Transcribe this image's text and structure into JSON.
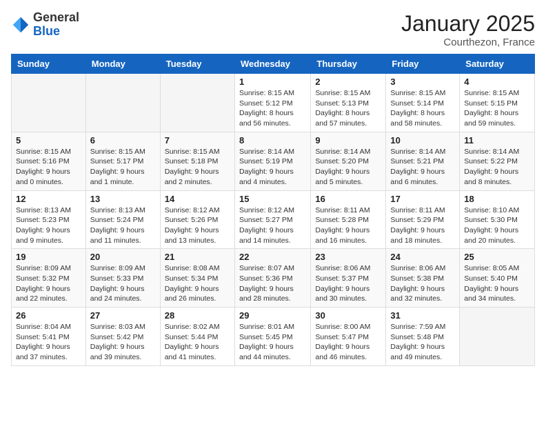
{
  "logo": {
    "general": "General",
    "blue": "Blue"
  },
  "header": {
    "month": "January 2025",
    "location": "Courthezon, France"
  },
  "weekdays": [
    "Sunday",
    "Monday",
    "Tuesday",
    "Wednesday",
    "Thursday",
    "Friday",
    "Saturday"
  ],
  "weeks": [
    [
      {
        "day": "",
        "info": ""
      },
      {
        "day": "",
        "info": ""
      },
      {
        "day": "",
        "info": ""
      },
      {
        "day": "1",
        "info": "Sunrise: 8:15 AM\nSunset: 5:12 PM\nDaylight: 8 hours\nand 56 minutes."
      },
      {
        "day": "2",
        "info": "Sunrise: 8:15 AM\nSunset: 5:13 PM\nDaylight: 8 hours\nand 57 minutes."
      },
      {
        "day": "3",
        "info": "Sunrise: 8:15 AM\nSunset: 5:14 PM\nDaylight: 8 hours\nand 58 minutes."
      },
      {
        "day": "4",
        "info": "Sunrise: 8:15 AM\nSunset: 5:15 PM\nDaylight: 8 hours\nand 59 minutes."
      }
    ],
    [
      {
        "day": "5",
        "info": "Sunrise: 8:15 AM\nSunset: 5:16 PM\nDaylight: 9 hours\nand 0 minutes."
      },
      {
        "day": "6",
        "info": "Sunrise: 8:15 AM\nSunset: 5:17 PM\nDaylight: 9 hours\nand 1 minute."
      },
      {
        "day": "7",
        "info": "Sunrise: 8:15 AM\nSunset: 5:18 PM\nDaylight: 9 hours\nand 2 minutes."
      },
      {
        "day": "8",
        "info": "Sunrise: 8:14 AM\nSunset: 5:19 PM\nDaylight: 9 hours\nand 4 minutes."
      },
      {
        "day": "9",
        "info": "Sunrise: 8:14 AM\nSunset: 5:20 PM\nDaylight: 9 hours\nand 5 minutes."
      },
      {
        "day": "10",
        "info": "Sunrise: 8:14 AM\nSunset: 5:21 PM\nDaylight: 9 hours\nand 6 minutes."
      },
      {
        "day": "11",
        "info": "Sunrise: 8:14 AM\nSunset: 5:22 PM\nDaylight: 9 hours\nand 8 minutes."
      }
    ],
    [
      {
        "day": "12",
        "info": "Sunrise: 8:13 AM\nSunset: 5:23 PM\nDaylight: 9 hours\nand 9 minutes."
      },
      {
        "day": "13",
        "info": "Sunrise: 8:13 AM\nSunset: 5:24 PM\nDaylight: 9 hours\nand 11 minutes."
      },
      {
        "day": "14",
        "info": "Sunrise: 8:12 AM\nSunset: 5:26 PM\nDaylight: 9 hours\nand 13 minutes."
      },
      {
        "day": "15",
        "info": "Sunrise: 8:12 AM\nSunset: 5:27 PM\nDaylight: 9 hours\nand 14 minutes."
      },
      {
        "day": "16",
        "info": "Sunrise: 8:11 AM\nSunset: 5:28 PM\nDaylight: 9 hours\nand 16 minutes."
      },
      {
        "day": "17",
        "info": "Sunrise: 8:11 AM\nSunset: 5:29 PM\nDaylight: 9 hours\nand 18 minutes."
      },
      {
        "day": "18",
        "info": "Sunrise: 8:10 AM\nSunset: 5:30 PM\nDaylight: 9 hours\nand 20 minutes."
      }
    ],
    [
      {
        "day": "19",
        "info": "Sunrise: 8:09 AM\nSunset: 5:32 PM\nDaylight: 9 hours\nand 22 minutes."
      },
      {
        "day": "20",
        "info": "Sunrise: 8:09 AM\nSunset: 5:33 PM\nDaylight: 9 hours\nand 24 minutes."
      },
      {
        "day": "21",
        "info": "Sunrise: 8:08 AM\nSunset: 5:34 PM\nDaylight: 9 hours\nand 26 minutes."
      },
      {
        "day": "22",
        "info": "Sunrise: 8:07 AM\nSunset: 5:36 PM\nDaylight: 9 hours\nand 28 minutes."
      },
      {
        "day": "23",
        "info": "Sunrise: 8:06 AM\nSunset: 5:37 PM\nDaylight: 9 hours\nand 30 minutes."
      },
      {
        "day": "24",
        "info": "Sunrise: 8:06 AM\nSunset: 5:38 PM\nDaylight: 9 hours\nand 32 minutes."
      },
      {
        "day": "25",
        "info": "Sunrise: 8:05 AM\nSunset: 5:40 PM\nDaylight: 9 hours\nand 34 minutes."
      }
    ],
    [
      {
        "day": "26",
        "info": "Sunrise: 8:04 AM\nSunset: 5:41 PM\nDaylight: 9 hours\nand 37 minutes."
      },
      {
        "day": "27",
        "info": "Sunrise: 8:03 AM\nSunset: 5:42 PM\nDaylight: 9 hours\nand 39 minutes."
      },
      {
        "day": "28",
        "info": "Sunrise: 8:02 AM\nSunset: 5:44 PM\nDaylight: 9 hours\nand 41 minutes."
      },
      {
        "day": "29",
        "info": "Sunrise: 8:01 AM\nSunset: 5:45 PM\nDaylight: 9 hours\nand 44 minutes."
      },
      {
        "day": "30",
        "info": "Sunrise: 8:00 AM\nSunset: 5:47 PM\nDaylight: 9 hours\nand 46 minutes."
      },
      {
        "day": "31",
        "info": "Sunrise: 7:59 AM\nSunset: 5:48 PM\nDaylight: 9 hours\nand 49 minutes."
      },
      {
        "day": "",
        "info": ""
      }
    ]
  ]
}
